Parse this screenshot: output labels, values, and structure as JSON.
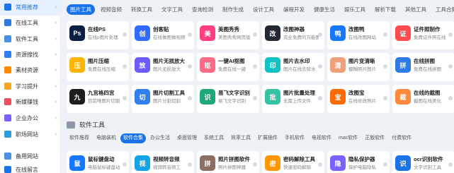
{
  "sidebar": {
    "items": [
      {
        "label": "常用推荐",
        "active": true,
        "color": "#1a73e8",
        "icon": "thumbs-up-icon"
      },
      {
        "label": "在线工具",
        "active": false,
        "color": "#2d7be5",
        "icon": "wrench-icon"
      },
      {
        "label": "软件工具",
        "active": false,
        "color": "#4a90e2",
        "icon": "window-icon"
      },
      {
        "label": "资源搜找",
        "active": false,
        "color": "#2f80ed",
        "icon": "search-icon"
      },
      {
        "label": "素材资源",
        "active": false,
        "color": "#ff8a00",
        "icon": "box-icon"
      },
      {
        "label": "学习提升",
        "active": false,
        "color": "#f5a623",
        "icon": "book-icon"
      },
      {
        "label": "新媒赚钱",
        "active": false,
        "color": "#e94f64",
        "icon": "megaphone-icon"
      },
      {
        "label": "企业办公",
        "active": false,
        "color": "#7b61ff",
        "icon": "briefcase-icon"
      },
      {
        "label": "职场网站",
        "active": false,
        "color": "#2d9cdb",
        "icon": "person-icon"
      },
      {
        "label": "备用网站",
        "active": false,
        "color": "#4a90e2",
        "icon": "globe-icon"
      },
      {
        "label": "在线留言",
        "active": false,
        "color": "#1a73e8",
        "icon": "message-icon"
      }
    ]
  },
  "tabs": [
    "图片工具",
    "视频音频",
    "转换工具",
    "文字工具",
    "查询检测",
    "制作生成",
    "设计工具",
    "编程开发",
    "健康生活",
    "娱乐工具",
    "解析下载",
    "其他工具",
    "工具合集"
  ],
  "active_tab": 0,
  "cards": [
    {
      "title": "在线PS",
      "desc": "在线p图片处理",
      "color": "#0a1f44",
      "glyph": "Ps"
    },
    {
      "title": "创客贴",
      "desc": "在线做图做视频",
      "color": "#2f6bff",
      "glyph": "创"
    },
    {
      "title": "美图秀秀",
      "desc": "美图秀秀网页版",
      "color": "#ff3d7f",
      "glyph": "美"
    },
    {
      "title": "改图神器",
      "desc": "完全免费的万能图",
      "color": "#222831",
      "glyph": "改"
    },
    {
      "title": "改图鸭",
      "desc": "在线改图网站",
      "color": "#1677ff",
      "glyph": "鸭"
    },
    {
      "title": "证件照制作",
      "desc": "免费证件照在线",
      "color": "#ff4d4f",
      "glyph": "证"
    },
    {
      "title": "图片压缩",
      "desc": "免费在线压缩",
      "color": "#ffb400",
      "glyph": "压"
    },
    {
      "title": "图片无损放大",
      "desc": "图片无损放大",
      "color": "#6a5cff",
      "glyph": "放"
    },
    {
      "title": "一键AI抠图",
      "desc": "免费在线一键",
      "color": "#ff6a88",
      "glyph": "抠"
    },
    {
      "title": "图片去水印",
      "desc": "图片在线去除水",
      "color": "#13c2c2",
      "glyph": "印"
    },
    {
      "title": "图片变清晰",
      "desc": "模糊照片图片",
      "color": "#f0a07a",
      "glyph": "清"
    },
    {
      "title": "在线拼图",
      "desc": "免费在线拼图",
      "color": "#2d7be5",
      "glyph": "拼"
    },
    {
      "title": "九宫格四宫",
      "desc": "目前唯图片切割",
      "color": "#1d1d1f",
      "glyph": "九"
    },
    {
      "title": "图片切割工具",
      "desc": "图片分割切割",
      "color": "#2f80ed",
      "glyph": "切"
    },
    {
      "title": "易飞文字识别",
      "desc": "易飞文字识别",
      "color": "#1fa67a",
      "glyph": "识"
    },
    {
      "title": "图片批量处理",
      "desc": "无需上传文件",
      "color": "#36c3a5",
      "glyph": "批"
    },
    {
      "title": "改图宝",
      "desc": "在线修改照片",
      "color": "#ff6a00",
      "glyph": "宝"
    },
    {
      "title": "在线的截图",
      "desc": "截图在线美化",
      "color": "#ff8a3d",
      "glyph": "截"
    }
  ],
  "section": {
    "title": "软件工具",
    "icon": "folder-icon"
  },
  "tabs2": [
    "软件推荐",
    "电脑装机",
    "软件合集",
    "办公生活",
    "桌面管理",
    "系统工具",
    "效率工具",
    "扩展插件",
    "手机软件",
    "电视软件",
    "mac软件",
    "正版软件",
    "付费软件"
  ],
  "active_tab2": 2,
  "cards2": [
    {
      "title": "鼠标键盘动",
      "desc": "电脑鼠标键盘动",
      "color": "#1677ff",
      "glyph": "鼠"
    },
    {
      "title": "视频转音频",
      "desc": "视频转音频工",
      "color": "#13a3e8",
      "glyph": "视"
    },
    {
      "title": "照片拼图软件",
      "desc": "照片拼图神器",
      "color": "#8d6e63",
      "glyph": "拼"
    },
    {
      "title": "密码解除工具",
      "desc": "快速密码解除",
      "color": "#ff9800",
      "glyph": "密"
    },
    {
      "title": "隐私保护器",
      "desc": "保护电脑隐私",
      "color": "#7b61ff",
      "glyph": "隐"
    },
    {
      "title": "ocr识别软件",
      "desc": "文字识别工具",
      "color": "#1a73e8",
      "glyph": "识"
    }
  ]
}
